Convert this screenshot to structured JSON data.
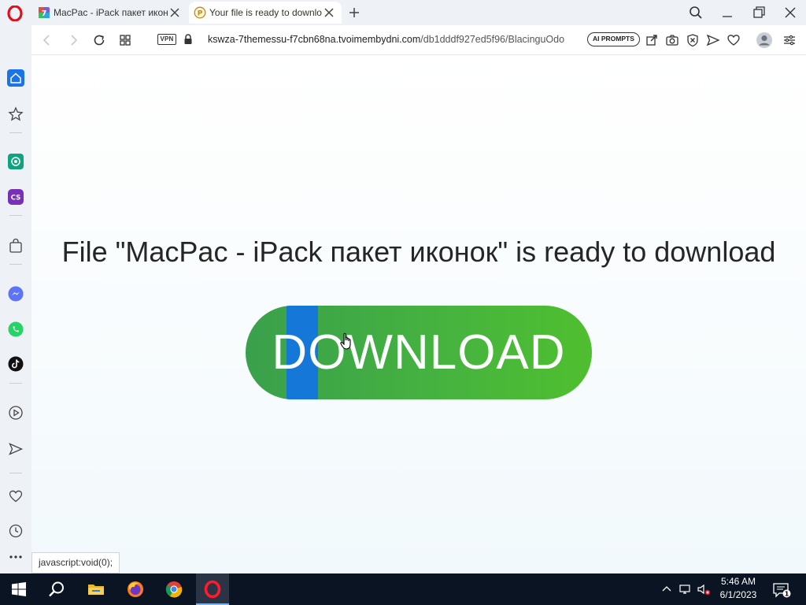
{
  "browser": {
    "tabs": [
      {
        "title": "MacPac - iPack пакет икон",
        "favicon": "colorful-grid-favicon",
        "active": false
      },
      {
        "title": "Your file is ready to downlo",
        "favicon": "p-circle-favicon",
        "active": true
      }
    ],
    "address": {
      "vpn_label": "VPN",
      "url_host": "kswza-7themessu-f7cbn68na.tvoimembydni.com",
      "url_path": "/db1dddf927ed5f96/BlacinguOdo",
      "ai_prompts_label": "AI PROMPTS"
    },
    "sidebar_icons": [
      "home-icon",
      "star-icon",
      "chatgpt-icon",
      "cs-icon",
      "bag-icon",
      "messenger-icon",
      "whatsapp-icon",
      "tiktok-icon",
      "player-icon",
      "send-icon",
      "heart-icon",
      "history-icon",
      "more-icon"
    ]
  },
  "page": {
    "headline": "File \"MacPac - iPack пакет иконок\" is ready to download",
    "download_label": "DOWNLOAD",
    "button_color": "#46b43e",
    "selection_color": "#1577d8"
  },
  "status_tip": "javascript:void(0);",
  "taskbar": {
    "apps": [
      "windows-start-icon",
      "search-icon",
      "file-explorer-icon",
      "firefox-icon",
      "chrome-icon",
      "opera-icon"
    ],
    "time": "5:46 AM",
    "date": "6/1/2023",
    "notification_count": "1"
  }
}
